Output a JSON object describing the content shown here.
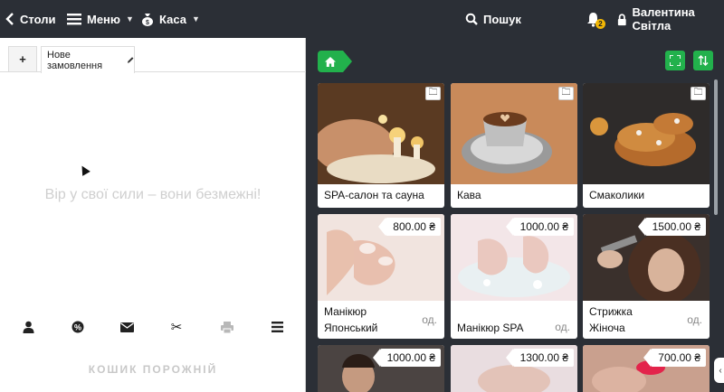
{
  "topbar": {
    "back_label": "Столи",
    "menu_label": "Меню",
    "kasa_label": "Каса",
    "search_label": "Пошук",
    "notifications_count": "2",
    "user_name": "Валентина Світла"
  },
  "left": {
    "add_tab_label": "+",
    "order_tab_label": "Нове замовлення",
    "motto": "Вір у свої сили – вони безмежні!",
    "empty_cart_label": "КОШИК ПОРОЖНІЙ",
    "actions": [
      "user-icon",
      "percent-icon",
      "envelope-icon",
      "scissors-icon",
      "printer-icon",
      "menu-lines-icon"
    ]
  },
  "right": {
    "categories": [
      {
        "title": "SPA-салон та сауна"
      },
      {
        "title": "Кава"
      },
      {
        "title": "Смаколики"
      }
    ],
    "products": [
      {
        "title_line1": "Манікюр",
        "title_line2": "Японський",
        "unit": "од.",
        "price": "800.00 ₴"
      },
      {
        "title_line1": "Манікюр SPA",
        "title_line2": "",
        "unit": "од.",
        "price": "1000.00 ₴"
      },
      {
        "title_line1": "Стрижка",
        "title_line2": "Жіноча",
        "unit": "од.",
        "price": "1500.00 ₴"
      }
    ],
    "next_row_prices": [
      "1000.00 ₴",
      "1300.00 ₴",
      "700.00 ₴"
    ]
  },
  "colors": {
    "dark_bg": "#2b2f36",
    "accent_green": "#22b14c",
    "badge_yellow": "#f2b705"
  }
}
